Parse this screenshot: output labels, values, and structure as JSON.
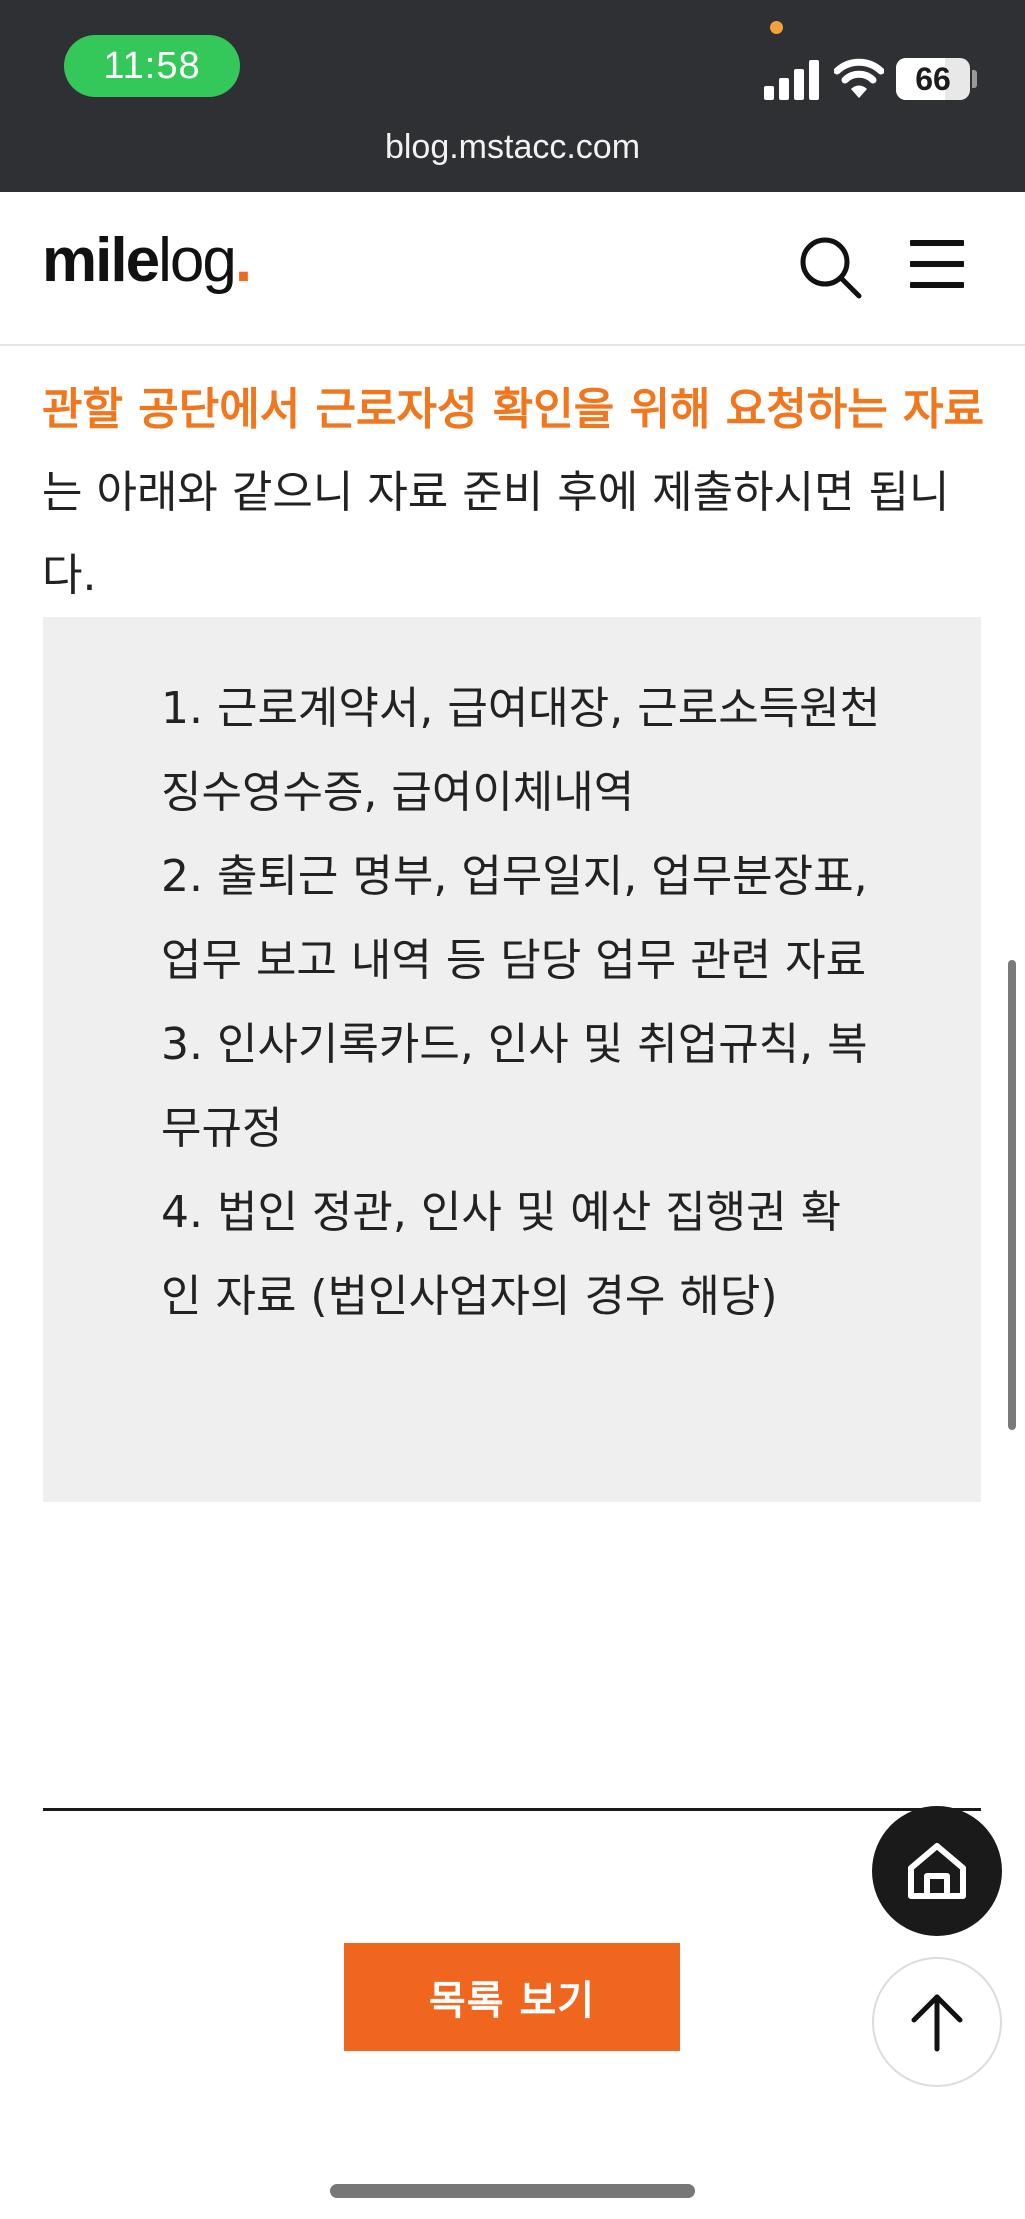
{
  "status_bar": {
    "time": "11:58",
    "battery_percent": "66",
    "battery_level": 0.66,
    "signal_icon": "cellular-signal-icon",
    "wifi_icon": "wifi-icon",
    "privacy_indicator_color": "#f5a13a"
  },
  "browser": {
    "url": "blog.mstacc.com"
  },
  "header": {
    "logo_bold": "mile",
    "logo_light": "log",
    "logo_dot": ".",
    "search_icon": "search-icon",
    "menu_icon": "hamburger-menu-icon"
  },
  "article": {
    "intro_highlight": "관할 공단에서 근로자성 확인을 위해 요청하는 자료",
    "intro_rest": "는 아래와 같으니 자료 준비 후에 제출하시면 됩니다.",
    "documents": [
      "1. 근로계약서, 급여대장, 근로소득원천징수영수증, 급여이체내역",
      "2. 출퇴근 명부, 업무일지, 업무분장표, 업무 보고 내역 등 담당 업무 관련 자료",
      "3. 인사기록카드, 인사 및 취업규칙, 복무규정",
      "4. 법인 정관, 인사 및 예산 집행권 확인 자료 (법인사업자의 경우 해당)"
    ]
  },
  "actions": {
    "list_button": "목록 보기",
    "home_icon": "home-icon",
    "top_icon": "arrow-up-icon"
  },
  "colors": {
    "accent": "#f0661e",
    "highlight_text": "#f0771e",
    "box_background": "#efefef"
  }
}
